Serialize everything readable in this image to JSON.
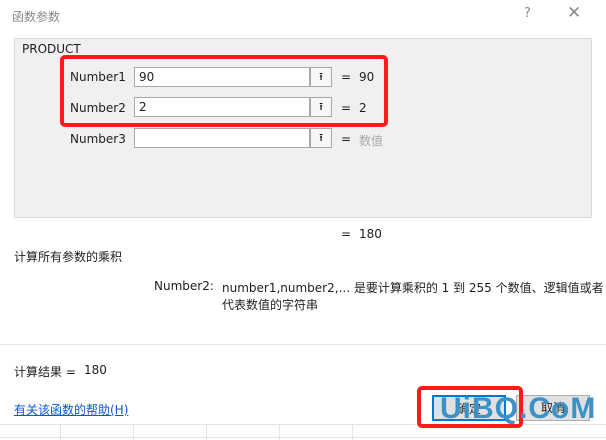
{
  "window": {
    "title": "函数参数",
    "help_glyph": "?",
    "close_glyph": "✕"
  },
  "function_name": "PRODUCT",
  "arguments": [
    {
      "label": "Number1",
      "value": "90",
      "eq": "=",
      "result": "90"
    },
    {
      "label": "Number2",
      "value": "2",
      "eq": "=",
      "result": "2"
    },
    {
      "label": "Number3",
      "value": "",
      "eq": "=",
      "result": "数值"
    }
  ],
  "picker_glyph": "⭱",
  "formula_result": {
    "eq": "=",
    "value": "180"
  },
  "description": "计算所有参数的乘积",
  "arg_help": {
    "name": "Number2:",
    "line1": "number1,number2,... 是要计算乘积的 1 到 255 个数值、逻辑值或者",
    "line2": "代表数值的字符串"
  },
  "calc_result": {
    "label": "计算结果 =",
    "value": "180"
  },
  "help_link": "有关该函数的帮助(H)",
  "buttons": {
    "ok": "确定",
    "cancel": "取消"
  },
  "watermark": "UiBQ.CoM",
  "colors": {
    "highlight": "#ff1a1a",
    "link": "#0b57d0",
    "dim": "#a8a8a8"
  }
}
